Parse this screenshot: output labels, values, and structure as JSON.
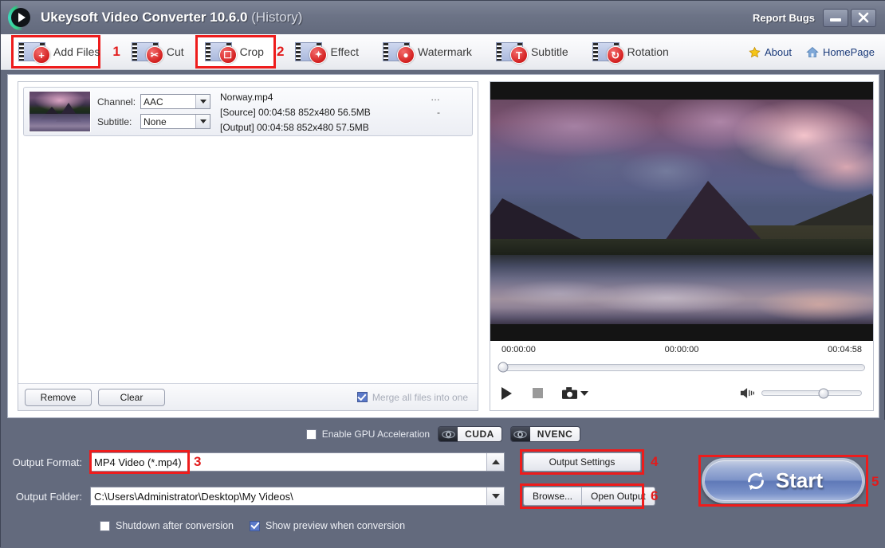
{
  "window": {
    "title": "Ukeysoft Video Converter 10.6.0",
    "title_suffix": "(History)",
    "report_bugs": "Report Bugs",
    "minimize_icon": "minimize-icon",
    "close_icon": "close-icon",
    "logo_icon": "app-logo-icon"
  },
  "toolbar": {
    "items": [
      {
        "label": "Add Files",
        "icon": "add-files-icon",
        "badge": "+",
        "highlighted": true,
        "marker": "1"
      },
      {
        "label": "Cut",
        "icon": "cut-icon",
        "badge": "✂",
        "highlighted": false,
        "marker": ""
      },
      {
        "label": "Crop",
        "icon": "crop-icon",
        "badge": "⧉",
        "highlighted": true,
        "marker": "2"
      },
      {
        "label": "Effect",
        "icon": "effect-icon",
        "badge": "✦",
        "highlighted": false,
        "marker": ""
      },
      {
        "label": "Watermark",
        "icon": "watermark-icon",
        "badge": "●",
        "highlighted": false,
        "marker": ""
      },
      {
        "label": "Subtitle",
        "icon": "subtitle-icon",
        "badge": "T",
        "highlighted": false,
        "marker": ""
      },
      {
        "label": "Rotation",
        "icon": "rotation-icon",
        "badge": "↺",
        "highlighted": false,
        "marker": ""
      }
    ],
    "about_label": "About",
    "about_icon": "star-icon",
    "homepage_label": "HomePage",
    "homepage_icon": "home-icon"
  },
  "file_list": {
    "item": {
      "thumbnail": "video-thumbnail",
      "channel_label": "Channel:",
      "channel_value": "AAC",
      "subtitle_label": "Subtitle:",
      "subtitle_value": "None",
      "filename": "Norway.mp4",
      "source_line": "[Source]  00:04:58  852x480  56.5MB",
      "output_line": "[Output]  00:04:58  852x480  57.5MB",
      "more_menu": "…",
      "status_dash": "-"
    },
    "remove_label": "Remove",
    "clear_label": "Clear",
    "merge_label": "Merge all files into one",
    "merge_checked": true
  },
  "player": {
    "time_start": "00:00:00",
    "time_current": "00:00:00",
    "time_total": "00:04:58",
    "play_icon": "play-icon",
    "stop_icon": "stop-icon",
    "snapshot_icon": "camera-icon",
    "volume_icon": "volume-icon",
    "seek_position_pct": 0,
    "volume_position_pct": 62
  },
  "gpu": {
    "label": "Enable GPU Acceleration",
    "checked": false,
    "cuda_label": "CUDA",
    "nvenc_label": "NVENC",
    "cuda_icon": "nvidia-icon",
    "nvenc_icon": "nvidia-icon"
  },
  "output": {
    "format_label": "Output Format:",
    "format_value": "MP4 Video (*.mp4)",
    "format_marker": "3",
    "settings_label": "Output Settings",
    "settings_marker": "4",
    "folder_label": "Output Folder:",
    "folder_value": "C:\\Users\\Administrator\\Desktop\\My Videos\\",
    "browse_label": "Browse...",
    "open_output_label": "Open Output",
    "browse_marker": "6"
  },
  "footer": {
    "shutdown_label": "Shutdown after conversion",
    "shutdown_checked": false,
    "preview_label": "Show preview when conversion",
    "preview_checked": true
  },
  "start": {
    "label": "Start",
    "icon": "refresh-icon",
    "marker": "5"
  },
  "colors": {
    "chrome": "#636a7d",
    "accent_red": "#ee1c1c",
    "link_blue": "#1a3a7a",
    "badge_red": "#d32020"
  }
}
